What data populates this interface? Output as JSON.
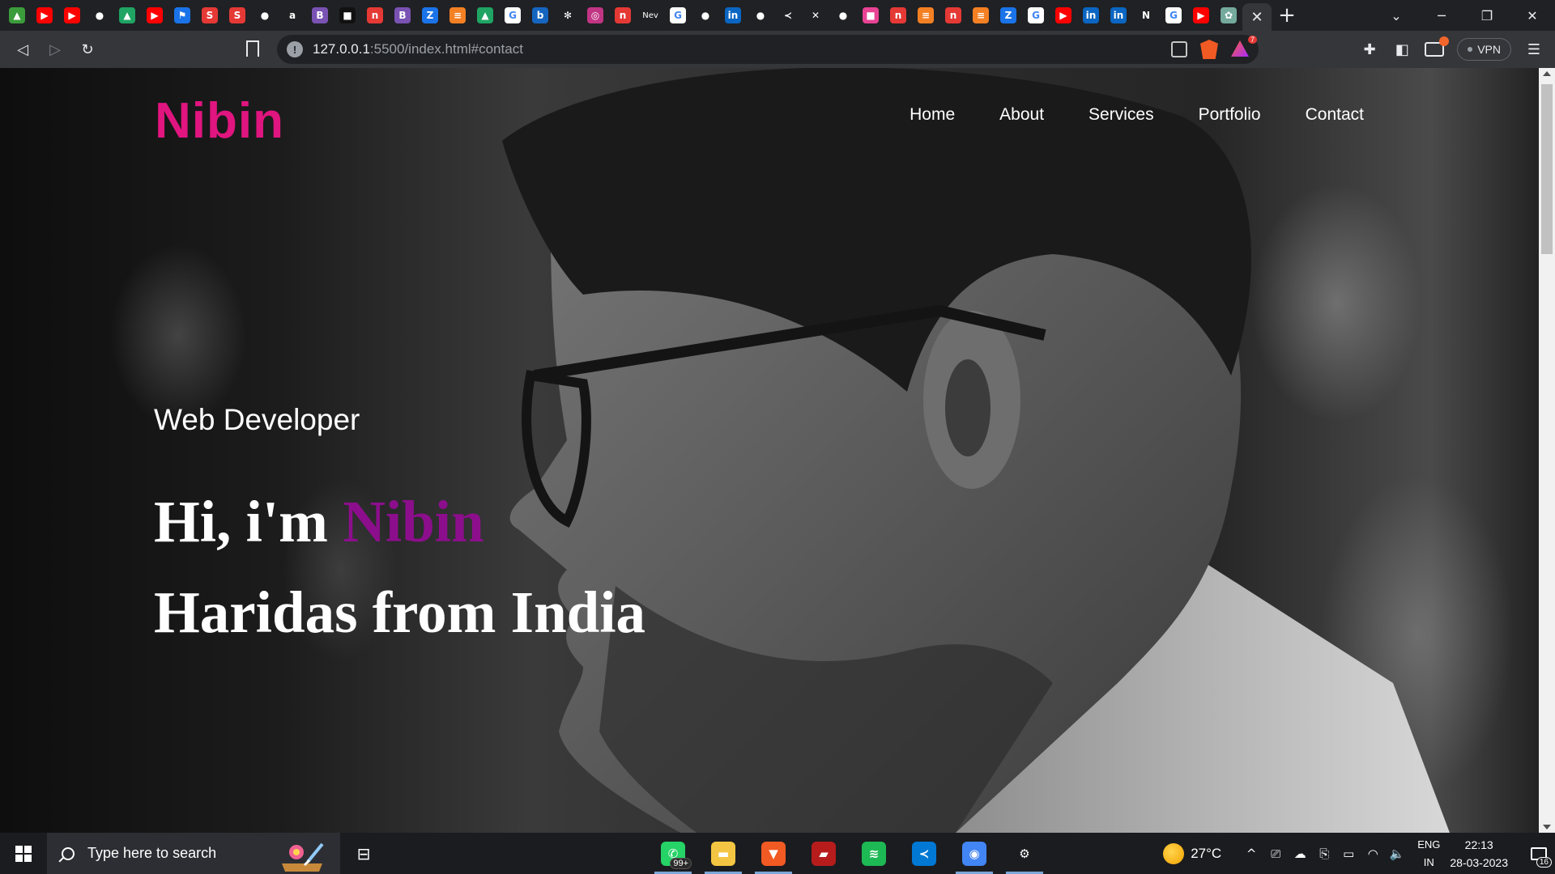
{
  "browser": {
    "tab_favicons": [
      {
        "name": "feedly-icon",
        "color": "#3b9c3b",
        "glyph": "▲"
      },
      {
        "name": "youtube-icon",
        "color": "#ff0000",
        "glyph": "▶"
      },
      {
        "name": "youtube-icon",
        "color": "#ff0000",
        "glyph": "▶"
      },
      {
        "name": "github-icon",
        "color": "#202124",
        "glyph": "●"
      },
      {
        "name": "google-drive-icon",
        "color": "#1fa463",
        "glyph": "▲"
      },
      {
        "name": "youtube-icon",
        "color": "#ff0000",
        "glyph": "▶"
      },
      {
        "name": "flag-icon",
        "color": "#1a73e8",
        "glyph": "⚑"
      },
      {
        "name": "s-red-icon",
        "color": "#e53935",
        "glyph": "S"
      },
      {
        "name": "s-red-icon",
        "color": "#e53935",
        "glyph": "S"
      },
      {
        "name": "github-icon",
        "color": "#202124",
        "glyph": "●"
      },
      {
        "name": "amazon-icon",
        "color": "#202124",
        "glyph": "a"
      },
      {
        "name": "bootstrap-icon",
        "color": "#7952b3",
        "glyph": "B"
      },
      {
        "name": "dark-site-icon",
        "color": "#111111",
        "glyph": "■"
      },
      {
        "name": "notion-red-icon",
        "color": "#e53935",
        "glyph": "n"
      },
      {
        "name": "bootstrap-icon",
        "color": "#7952b3",
        "glyph": "B"
      },
      {
        "name": "z-icon",
        "color": "#1a73e8",
        "glyph": "Z"
      },
      {
        "name": "stackoverflow-icon",
        "color": "#f48024",
        "glyph": "≡"
      },
      {
        "name": "google-drive-icon",
        "color": "#1fa463",
        "glyph": "▲"
      },
      {
        "name": "google-icon",
        "color": "#ffffff",
        "glyph": "G"
      },
      {
        "name": "b-blue-icon",
        "color": "#1565c0",
        "glyph": "b"
      },
      {
        "name": "react-icon",
        "color": "#202124",
        "glyph": "✻"
      },
      {
        "name": "instagram-icon",
        "color": "#c13584",
        "glyph": "◎"
      },
      {
        "name": "notion-red-icon",
        "color": "#e53935",
        "glyph": "n"
      },
      {
        "name": "new-tab-icon",
        "color": "#202124",
        "glyph": "Nev"
      },
      {
        "name": "google-icon",
        "color": "#ffffff",
        "glyph": "G"
      },
      {
        "name": "github-icon",
        "color": "#202124",
        "glyph": "●"
      },
      {
        "name": "linkedin-icon",
        "color": "#0a66c2",
        "glyph": "in"
      },
      {
        "name": "github-icon",
        "color": "#202124",
        "glyph": "●"
      },
      {
        "name": "vscode-icon",
        "color": "#202124",
        "glyph": "≺"
      },
      {
        "name": "deviantart-icon",
        "color": "#202124",
        "glyph": "✕"
      },
      {
        "name": "github-icon",
        "color": "#202124",
        "glyph": "●"
      },
      {
        "name": "pink-site-icon",
        "color": "#e84393",
        "glyph": "■"
      },
      {
        "name": "notion-red-icon",
        "color": "#e53935",
        "glyph": "n"
      },
      {
        "name": "stackoverflow-icon",
        "color": "#f48024",
        "glyph": "≡"
      },
      {
        "name": "notion-red-icon",
        "color": "#e53935",
        "glyph": "n"
      },
      {
        "name": "stackoverflow-icon",
        "color": "#f48024",
        "glyph": "≡"
      },
      {
        "name": "z-icon",
        "color": "#1a73e8",
        "glyph": "Z"
      },
      {
        "name": "google-icon",
        "color": "#ffffff",
        "glyph": "G"
      },
      {
        "name": "youtube-icon",
        "color": "#ff0000",
        "glyph": "▶"
      },
      {
        "name": "linkedin-icon",
        "color": "#0a66c2",
        "glyph": "in"
      },
      {
        "name": "linkedin-icon",
        "color": "#0a66c2",
        "glyph": "in"
      },
      {
        "name": "n-green-icon",
        "color": "#202124",
        "glyph": "N"
      },
      {
        "name": "google-icon",
        "color": "#ffffff",
        "glyph": "G"
      },
      {
        "name": "youtube-icon",
        "color": "#ff0000",
        "glyph": "▶"
      },
      {
        "name": "chatgpt-icon",
        "color": "#74aa9c",
        "glyph": "✿"
      }
    ],
    "active_tab_close": "✕",
    "new_tab": "+",
    "window_controls": {
      "tab_search": "⌄",
      "minimize": "─",
      "restore": "❐",
      "close": "✕"
    },
    "nav": {
      "back": "◁",
      "forward": "▷",
      "reload": "↻"
    },
    "url": {
      "host": "127.0.0.1",
      "rest": ":5500/index.html#contact"
    },
    "rewards_badge": "7",
    "toolbar_icons": {
      "extensions": "✚",
      "sidebar": "◧",
      "menu": "☰"
    },
    "vpn_label": "VPN"
  },
  "site": {
    "logo": "Nibin",
    "nav": [
      "Home",
      "About",
      "Services",
      "Portfolio",
      "Contact"
    ],
    "tagline": "Web Developer",
    "headline": {
      "line1_prefix": "Hi, i'm ",
      "line1_accent": "Nibin",
      "line2": "Haridas from India"
    }
  },
  "taskbar": {
    "search_placeholder": "Type here to search",
    "taskview_glyph": "⊟",
    "apps": [
      {
        "name": "whatsapp-icon",
        "color": "#25d366",
        "glyph": "✆",
        "badge": "99+",
        "active": true
      },
      {
        "name": "file-explorer-icon",
        "color": "#f4c542",
        "glyph": "▬",
        "active": true
      },
      {
        "name": "brave-browser-icon",
        "color": "#f25a23",
        "glyph": "▼",
        "active": true
      },
      {
        "name": "red-app-icon",
        "color": "#b71c1c",
        "glyph": "▰",
        "active": false
      },
      {
        "name": "spotify-icon",
        "color": "#1db954",
        "glyph": "≋",
        "active": false
      },
      {
        "name": "vscode-icon",
        "color": "#0078d4",
        "glyph": "≺",
        "active": false
      },
      {
        "name": "chrome-icon",
        "color": "#4285f4",
        "glyph": "◉",
        "active": true
      },
      {
        "name": "settings-icon",
        "color": "#1b1c20",
        "glyph": "⚙",
        "active": true
      }
    ],
    "weather": "27°C",
    "tray_icons": [
      "^",
      "⎚",
      "☁",
      "⎘",
      "▭",
      "◠",
      "🔈"
    ],
    "language": {
      "line1": "ENG",
      "line2": "IN"
    },
    "time": "22:13",
    "date": "28-03-2023",
    "notification_count": "16"
  }
}
